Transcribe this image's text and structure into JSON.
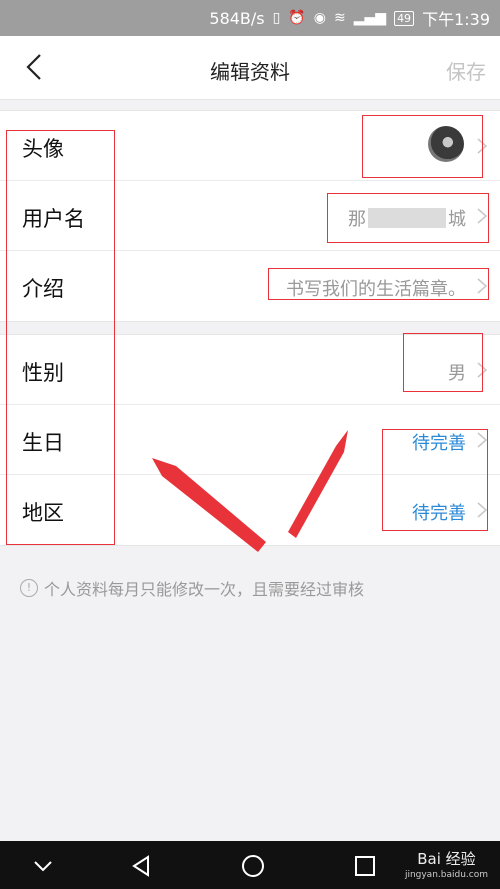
{
  "status": {
    "speed": "584B/s",
    "battery": "49",
    "time": "下午1:39"
  },
  "header": {
    "title": "编辑资料",
    "save_label": "保存"
  },
  "profile": {
    "avatar": {
      "label": "头像"
    },
    "username": {
      "label": "用户名",
      "value_start": "那",
      "value_end": "城"
    },
    "intro": {
      "label": "介绍",
      "value": "书写我们的生活篇章。"
    },
    "gender": {
      "label": "性别",
      "value": "男"
    },
    "birthday": {
      "label": "生日",
      "value": "待完善"
    },
    "region": {
      "label": "地区",
      "value": "待完善"
    }
  },
  "note": "个人资料每月只能修改一次，且需要经过审核",
  "watermark": {
    "brand": "Bai 经验",
    "site": "jingyan.baidu.com"
  },
  "colors": {
    "accent": "#2b8ad8",
    "highlight": "#e8333a"
  }
}
